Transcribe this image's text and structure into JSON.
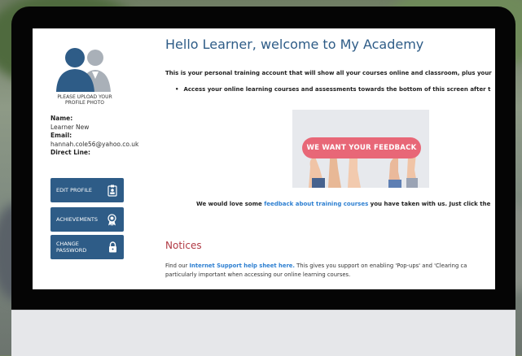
{
  "profile": {
    "upload_caption": "PLEASE UPLOAD YOUR PROFILE PHOTO",
    "name_label": "Name:",
    "name_value": "Learner New",
    "email_label": "Email:",
    "email_value": "hannah.cole56@yahoo.co.uk",
    "direct_line_label": "Direct Line:"
  },
  "sidebar": {
    "buttons": [
      {
        "label": "EDIT PROFILE",
        "icon": "id-badge-icon"
      },
      {
        "label": "ACHIEVEMENTS",
        "icon": "award-icon"
      },
      {
        "label_line1": "CHANGE",
        "label_line2": "PASSWORD",
        "icon": "lock-icon"
      }
    ]
  },
  "main": {
    "title": "Hello Learner, welcome to My Academy",
    "intro": "This is your personal training account that will show all your courses online and classroom, plus your",
    "bullet": "Access your online learning courses and assessments towards the bottom of this screen after t",
    "feedback_banner": "WE WANT YOUR FEEDBACK",
    "feedback_text_before": "We would love some ",
    "feedback_link": "feedback about training courses",
    "feedback_text_after": " you have taken with us.  Just click the",
    "notices_heading": "Notices",
    "find_before": "Find our ",
    "find_link": "Internet Support help sheet here.",
    "find_after": "  This gives you support on enabling 'Pop-ups' and 'Clearing ca",
    "find_line2": "particularly important when accessing our online learning courses."
  },
  "colors": {
    "accent": "#2e5c87",
    "link": "#2d7fd1",
    "notices": "#b13a44",
    "feedback_pill": "#e86777"
  }
}
